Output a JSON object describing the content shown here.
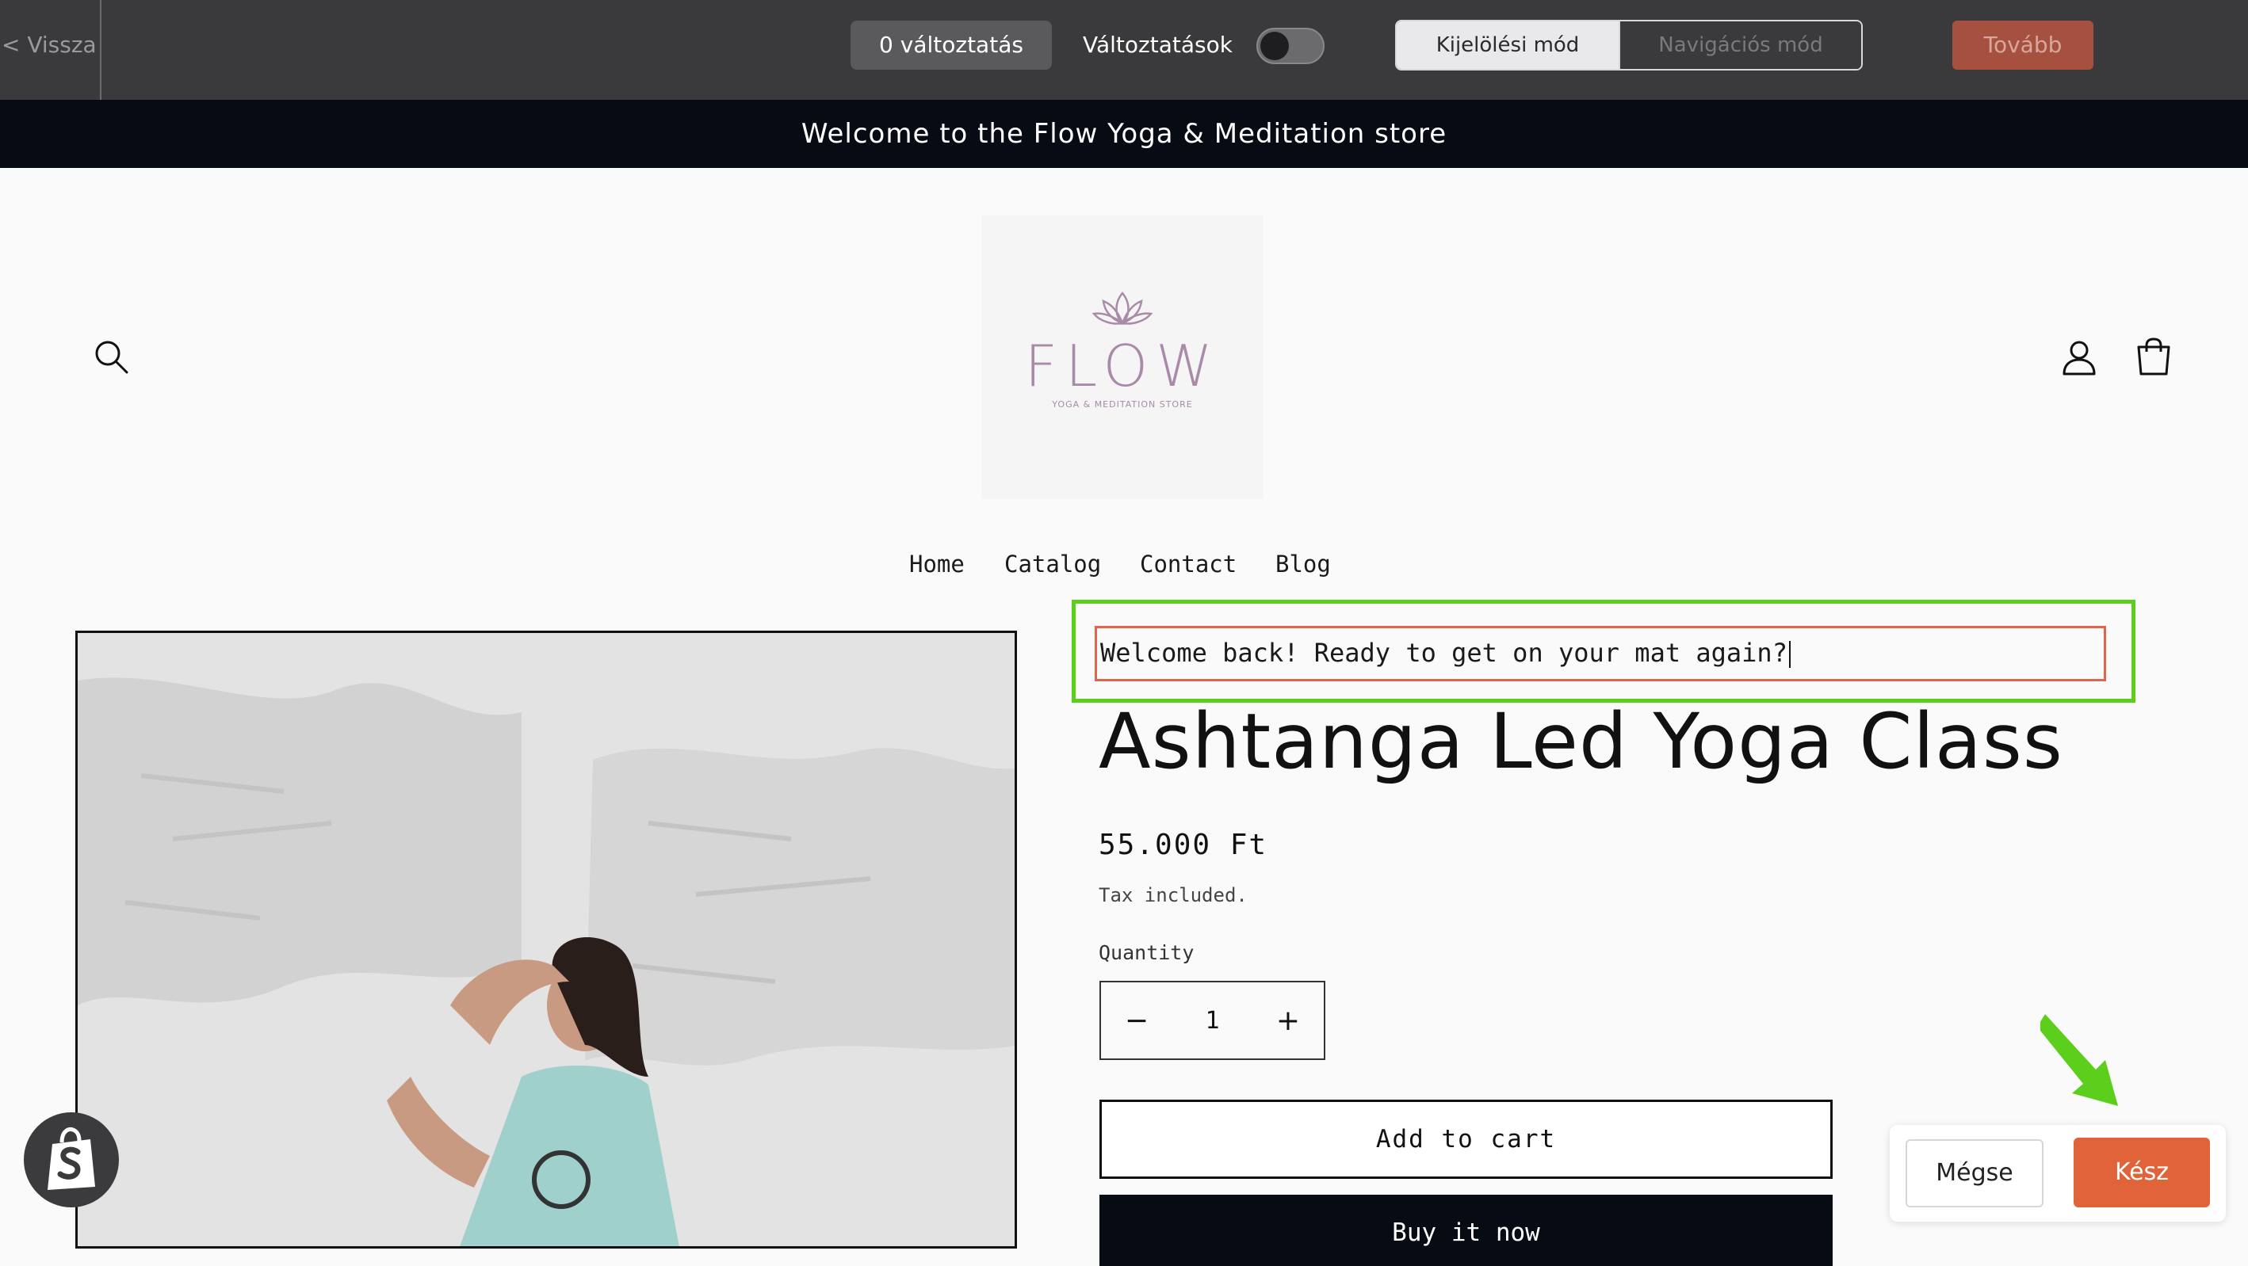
{
  "editor_bar": {
    "back_label": "< Vissza",
    "changes_count": "0 változtatás",
    "changes_toggle_label": "Változtatások",
    "mode_select": "Kijelölési mód",
    "mode_navigate": "Navigációs mód",
    "next_label": "Tovább"
  },
  "announcement": "Welcome to the Flow Yoga & Meditation store",
  "logo": {
    "text": "FLOW",
    "subtitle": "YOGA & MEDITATION STORE"
  },
  "nav": [
    "Home",
    "Catalog",
    "Contact",
    "Blog"
  ],
  "editable_text": "Welcome back! Ready to get on your mat again?",
  "product": {
    "title": "Ashtanga Led Yoga Class",
    "price": "55.000 Ft",
    "tax_note": "Tax included.",
    "quantity_label": "Quantity",
    "quantity_value": "1",
    "decrement": "−",
    "increment": "+",
    "add_to_cart": "Add to cart",
    "buy_now": "Buy it now"
  },
  "dialog": {
    "cancel_label": "Mégse",
    "done_label": "Kész"
  },
  "colors": {
    "editor_bar": "#3a3a3c",
    "announcement_bg": "#070b14",
    "highlight_green": "#5ccf1c",
    "input_border": "#e0654a",
    "done_button": "#e0633a",
    "logo_color": "#a98aa9"
  }
}
